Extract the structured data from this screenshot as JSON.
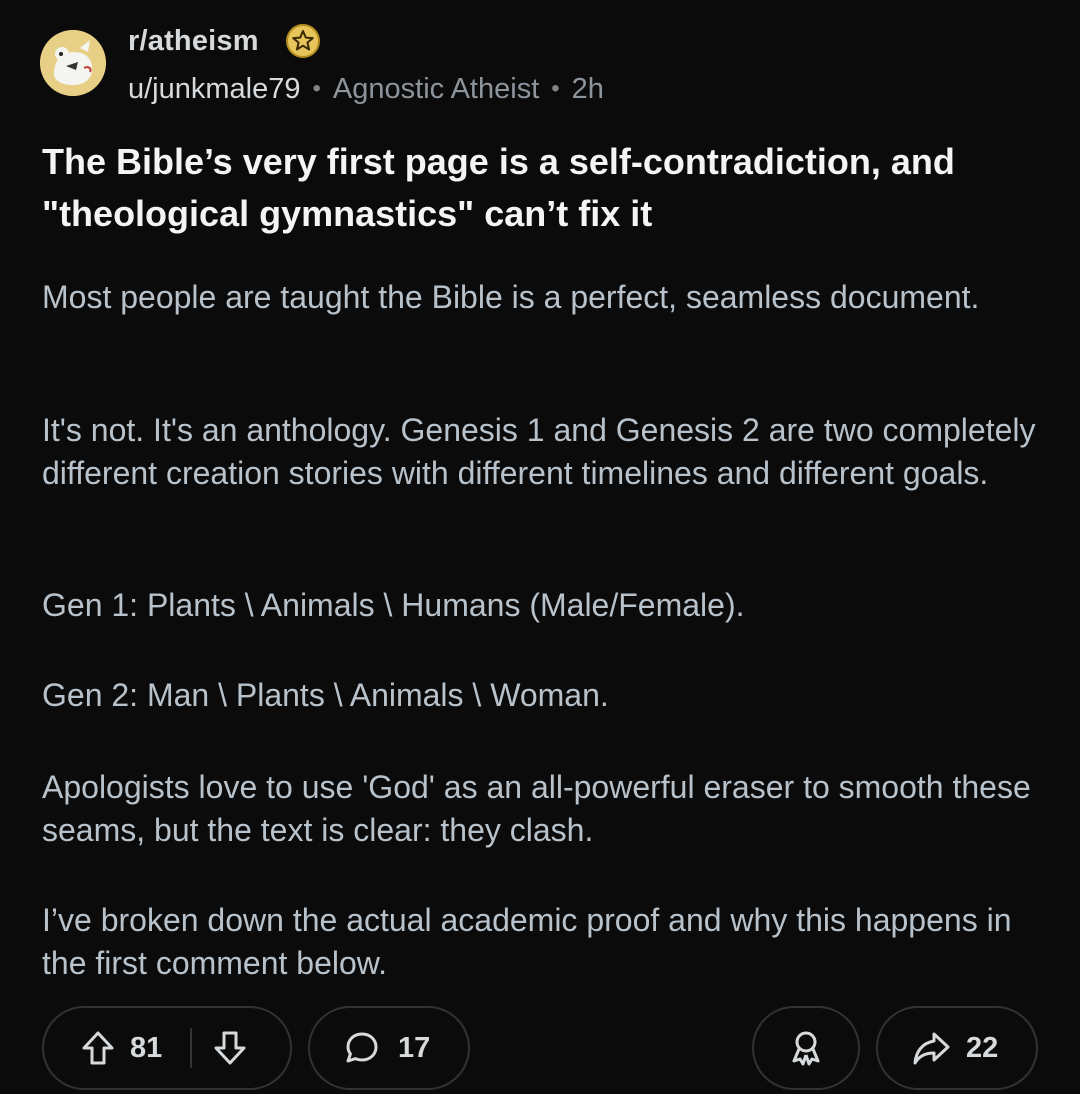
{
  "post": {
    "subreddit": "r/atheism",
    "username": "u/junkmale79",
    "flair": "Agnostic Atheist",
    "separator": "•",
    "time": "2h",
    "title": "The Bible’s very first page is a self-contradiction, and \"theological gymnastics\" can’t fix it",
    "body": [
      "Most people are taught the Bible is a perfect, seamless document.",
      "It's not. It's an anthology. Genesis 1 and Genesis 2 are two completely different creation stories with different timelines and different goals.",
      "Gen 1: Plants \\ Animals \\ Humans (Male/Female).",
      "Gen 2: Man \\ Plants \\ Animals \\ Woman.",
      "Apologists love to use 'God' as an all-powerful eraser to smooth these seams, but the text is clear: they clash.",
      "I’ve broken down the actual academic proof and why this happens in the first comment below."
    ]
  },
  "actions": {
    "votes": "81",
    "comments": "17",
    "shares": "22"
  },
  "icons": {
    "avatar": "subreddit-avatar",
    "badge": "achievement-star-badge-icon",
    "upvote": "upvote-arrow-icon",
    "downvote": "downvote-arrow-icon",
    "comment": "comment-bubble-icon",
    "award": "award-icon",
    "share": "share-arrow-icon"
  },
  "colors": {
    "background": "#0b0b0b",
    "title": "#f2f4f5",
    "body": "#b8c2cb",
    "meta": "#8d949b",
    "badge": "#e8c55a"
  }
}
